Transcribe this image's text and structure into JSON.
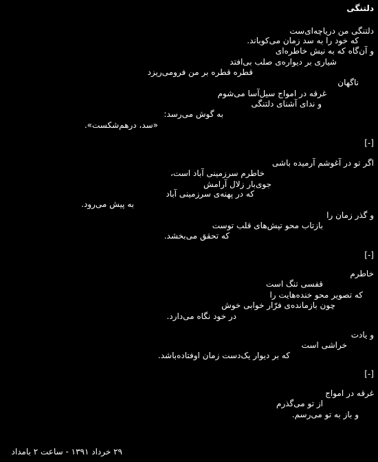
{
  "poem": {
    "title": "دلتنگی",
    "stanza1": [
      "دلتنگی من دریاچه‌ای‌ست",
      "که خود را به سد زمان می‌کوباند.",
      "و آن‌گاه که به نیش خاطره‌ای",
      "شیاری بر دیواره‌ی صلب بی‌افتد",
      "قطره قطره بر من فرومی‌ریزد",
      "ناگهان",
      "غرقه در امواج سیل‌آسا می‌شوم",
      "و ندای آشنای دلتنگی",
      "به گوش می‌رسد:",
      "«سد، درهم‌شکست»."
    ],
    "separator": "[-]",
    "stanza2a": [
      "اگر تو در آغوشم آرمیده باشی",
      "خاطرم سرزمینی آباد است،",
      "جوی‌بار زلال آرامش",
      "که در پهنه‌ی سرزمینی آباد",
      "به پیش می‌رود."
    ],
    "stanza2b": [
      "و گذر زمان را",
      "بازتاب محو تپش‌های قلب توست",
      "که تحقق می‌بخشد."
    ],
    "stanza3a": [
      "خاطرم",
      "قفسی تنگ است",
      "که تصویر محو خنده‌هایت را",
      "چون بازمانده‌ی فرّار خوابی خوش",
      "در خود نگاه می‌دارد."
    ],
    "stanza3b": [
      "و یادت",
      "خراشی است",
      "که بر دیوار یک‌دست زمان اوفتاده‌باشد."
    ],
    "stanza4": [
      "غرقه در امواج",
      "از تو می‌گذرم",
      "و باز به تو می‌رسم."
    ],
    "date": "۲۹ خرداد ۱۳۹۱ - ساعت ۲ بامداد"
  }
}
